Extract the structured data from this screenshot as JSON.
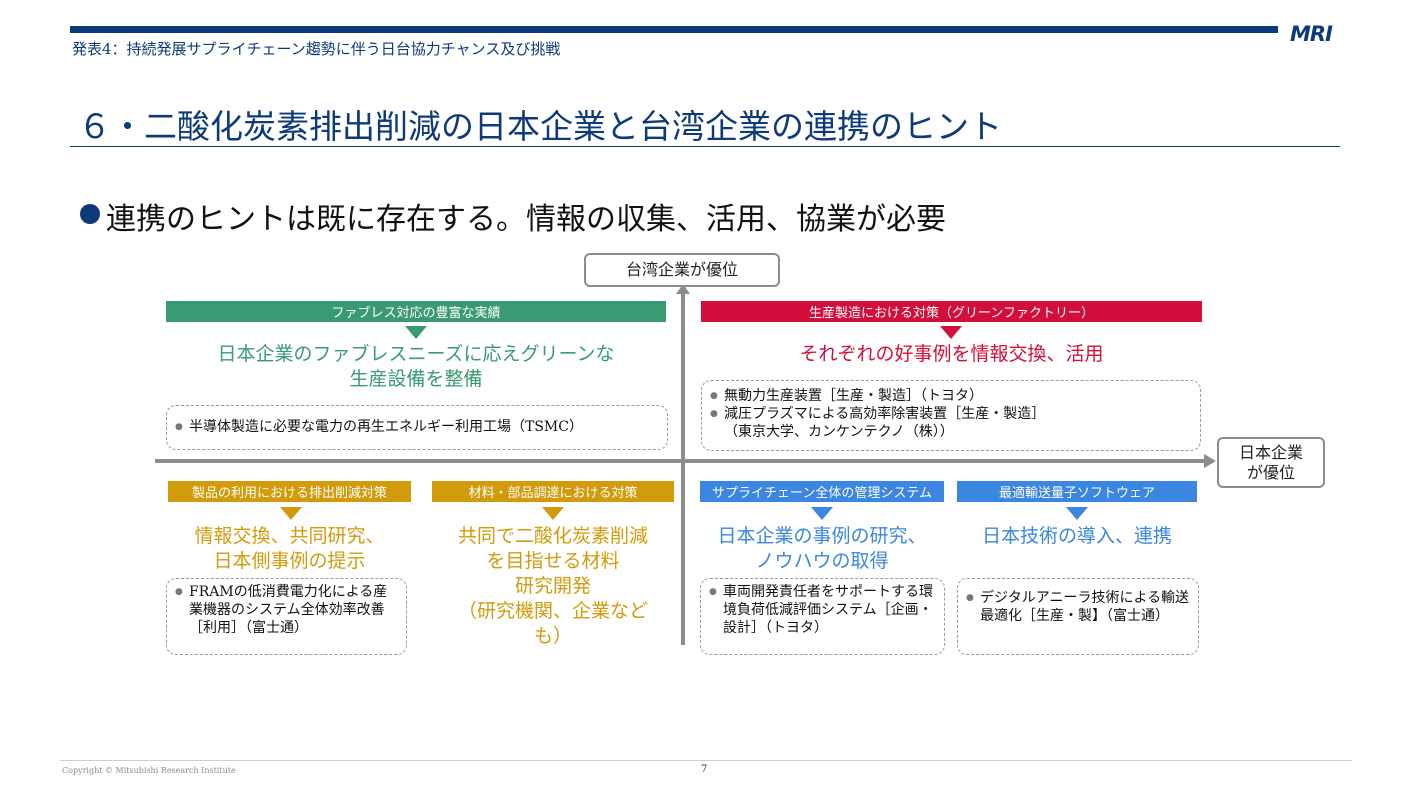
{
  "header": {
    "deck_subtitle": "発表4：持続発展サプライチェーン趨勢に伴う日台協力チャンス及び挑戦",
    "logo": "MRI",
    "slide_title": "６・二酸化炭素排出削減の日本企業と台湾企業の連携のヒント",
    "main_bullet": "連携のヒントは既に存在する。情報の収集、活用、協業が必要"
  },
  "axes": {
    "top_label": "台湾企業が優位",
    "right_label": "日本企業\nが優位"
  },
  "colors": {
    "green": "#3a9a74",
    "red": "#d20f3c",
    "gold": "#d29b0c",
    "blue": "#3a86e0",
    "navy": "#0e3a7a"
  },
  "quadrants": {
    "top_left": {
      "banner": "ファブレス対応の豊富な実績",
      "heading": "日本企業のファブレスニーズに応えグリーンな\n生産設備を整備",
      "items": [
        "半導体製造に必要な電力の再生エネルギー利用工場（TSMC）"
      ]
    },
    "top_right": {
      "banner": "生産製造における対策（グリーンファクトリー）",
      "heading": "それぞれの好事例を情報交換、活用",
      "items": [
        "無動力生産装置［生産・製造］（トヨタ）",
        "減圧プラズマによる高効率除害装置［生産・製造］\n（東京大学、カンケンテクノ（株））"
      ]
    },
    "bottom_1": {
      "banner": "製品の利用における排出削減対策",
      "heading": "情報交換、共同研究、\n日本側事例の提示",
      "items": [
        "FRAMの低消費電力化による産業機器のシステム全体効率改善［利用］（富士通）"
      ]
    },
    "bottom_2": {
      "banner": "材料・部品調達における対策",
      "heading": "共同で二酸化炭素削減\nを目指せる材料\n研究開発\n（研究機関、企業など\nも）"
    },
    "bottom_3": {
      "banner": "サプライチェーン全体の管理システム",
      "heading": "日本企業の事例の研究、\nノウハウの取得",
      "items": [
        "車両開発責任者をサポートする環境負荷低減評価システム［企画・設計］（トヨタ）"
      ]
    },
    "bottom_4": {
      "banner": "最適輸送量子ソフトウェア",
      "heading": "日本技術の導入、連携",
      "items": [
        "デジタルアニーラ技術による輸送最適化［生産・製】（富士通）"
      ]
    }
  },
  "footer": {
    "copyright": "Copyright © Mitsubishi Research Institute",
    "page_number": "7"
  }
}
